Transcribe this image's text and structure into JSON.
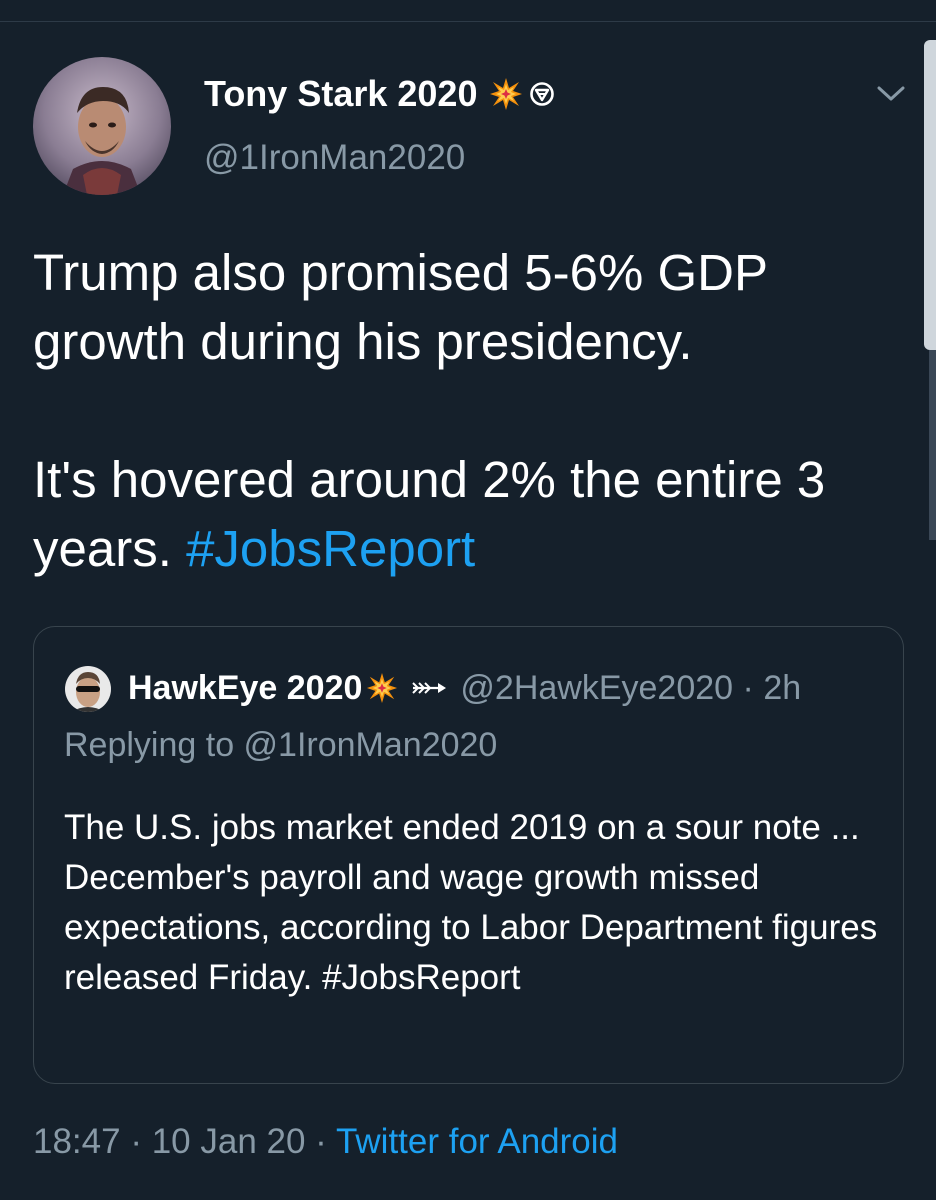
{
  "tweet": {
    "author": {
      "display_name": "Tony Stark 2020",
      "handle": "@1IronMan2020",
      "name_emoji": "collision-emoji",
      "name_badge": "resist-badge-icon"
    },
    "body": {
      "paragraph_1": "Trump also promised 5-6% GDP growth during his presidency.",
      "paragraph_2_text": "It's hovered around 2% the entire 3 years.",
      "paragraph_2_hashtag": "#JobsReport"
    },
    "timestamp": {
      "time": "18:47",
      "separator": " · ",
      "date": "10 Jan 20",
      "source": "Twitter for Android"
    }
  },
  "quoted_tweet": {
    "display_name": "HawkEye 2020",
    "name_emoji": "collision-emoji",
    "arrow_icon": "arrow-icon",
    "handle": "@2HawkEye2020",
    "separator": "·",
    "age": "2h",
    "replying_to_prefix": "Replying to ",
    "replying_to_handle": "@1IronMan2020",
    "text_line_1": "The U.S. jobs market ended 2019 on a sour note ...",
    "text_line_2": "December's payroll and wage growth missed expectations, according to Labor Department figures released Friday. #JobsReport"
  },
  "colors": {
    "background": "#15202b",
    "text_primary": "#ffffff",
    "text_secondary": "#8899a6",
    "accent": "#1da1f2",
    "border": "#38444d"
  }
}
